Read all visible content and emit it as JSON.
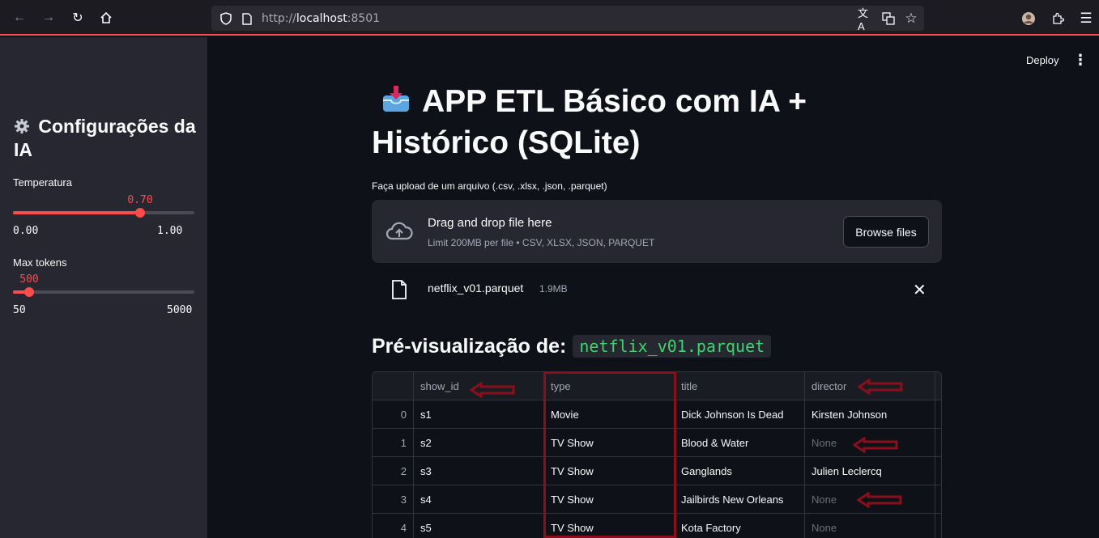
{
  "browser": {
    "url_dim": "http://",
    "url_host": "localhost",
    "url_port": ":8501"
  },
  "sidebar": {
    "title": "Configurações da IA",
    "title_icon": "gear-icon",
    "temperature": {
      "label": "Temperatura",
      "value": "0.70",
      "value_fraction": 0.7,
      "min": "0.00",
      "max": "1.00"
    },
    "max_tokens": {
      "label": "Max tokens",
      "value": "500",
      "value_fraction": 0.0909,
      "min": "50",
      "max": "5000"
    }
  },
  "header": {
    "deploy_label": "Deploy"
  },
  "main": {
    "title": "APP ETL Básico com IA + Histórico (SQLite)",
    "title_icon": "inbox-tray-icon",
    "upload_label": "Faça upload de um arquivo (.csv, .xlsx, .json, .parquet)",
    "dropzone": {
      "title": "Drag and drop file here",
      "subtitle": "Limit 200MB per file • CSV, XLSX, JSON, PARQUET",
      "browse_label": "Browse files"
    },
    "file": {
      "name": "netflix_v01.parquet",
      "size": "1.9MB"
    },
    "preview_heading": "Pré-visualização de:",
    "preview_file": "netflix_v01.parquet"
  },
  "table": {
    "columns": [
      "",
      "show_id",
      "type",
      "title",
      "director"
    ],
    "rows": [
      [
        "0",
        "s1",
        "Movie",
        "Dick Johnson Is Dead",
        "Kirsten Johnson"
      ],
      [
        "1",
        "s2",
        "TV Show",
        "Blood & Water",
        "None"
      ],
      [
        "2",
        "s3",
        "TV Show",
        "Ganglands",
        "Julien Leclercq"
      ],
      [
        "3",
        "s4",
        "TV Show",
        "Jailbirds New Orleans",
        "None"
      ],
      [
        "4",
        "s5",
        "TV Show",
        "Kota Factory",
        "None"
      ]
    ]
  },
  "colors": {
    "accent": "#ff4b4b",
    "annotation": "#8b0f1a",
    "background": "#0e1117",
    "sidebar": "#262730"
  }
}
